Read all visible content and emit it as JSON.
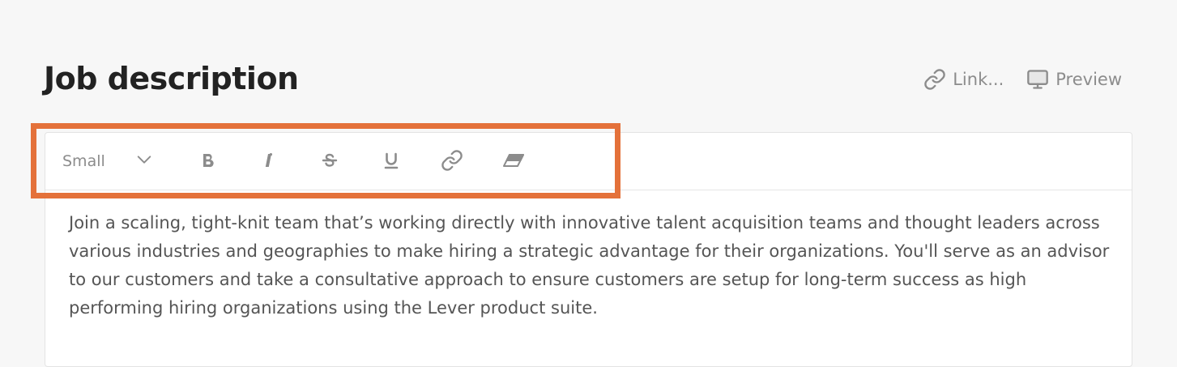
{
  "header": {
    "title": "Job description",
    "link_label": "Link...",
    "preview_label": "Preview"
  },
  "toolbar": {
    "size_value": "Small",
    "buttons": [
      "bold",
      "italic",
      "strikethrough",
      "underline",
      "link",
      "clear-formatting"
    ]
  },
  "editor": {
    "body": "Join a scaling, tight-knit team that’s working directly with innovative talent acquisition teams and thought leaders across various industries and geographies to make hiring a strategic advantage for their organizations. You'll serve as an advisor to our customers and take a consultative approach to ensure customers are setup for long-term success as high performing hiring organizations using the Lever product suite."
  },
  "colors": {
    "highlight": "#e4713a",
    "icon": "#8c8c8c",
    "text": "#555555",
    "title": "#222222"
  }
}
